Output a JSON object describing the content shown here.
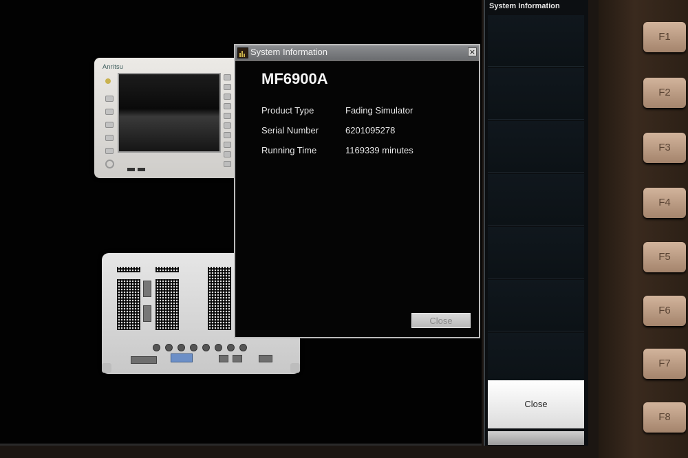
{
  "dialog": {
    "title": "System Information",
    "model": "MF6900A",
    "rows": [
      {
        "label": "Product Type",
        "value": "Fading Simulator"
      },
      {
        "label": "Serial Number",
        "value": "6201095278"
      },
      {
        "label": "Running Time",
        "value": "1169339 minutes"
      }
    ],
    "close_label": "Close",
    "close_glyph": "×"
  },
  "side_panel": {
    "title": "System Information",
    "close_label": "Close"
  },
  "fkeys": [
    "F1",
    "F2",
    "F3",
    "F4",
    "F5",
    "F6",
    "F7",
    "F8"
  ],
  "icons": {
    "dialog_title": "app-icon",
    "dialog_close": "close-icon"
  },
  "colors": {
    "screen_bg": "#020202",
    "titlebar": "#7a7c7f",
    "fkey": "#c0a088"
  }
}
